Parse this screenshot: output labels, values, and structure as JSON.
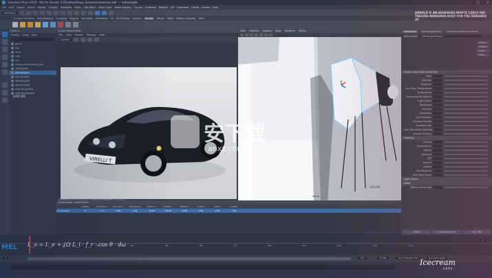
{
  "window": {
    "title": "Autodesk Maya 2018 - Not for Resale: E:\\Desktop\\Maya_Scenes\\scenes\\car.mb* --- aiAreaLight",
    "controls": [
      "–",
      "□",
      "×"
    ]
  },
  "menubar": {
    "items": [
      "File",
      "Edit",
      "Create",
      "Select",
      "Modify",
      "Display",
      "Windows",
      "Mesh",
      "Edit Mesh",
      "Mesh Tools",
      "Mesh Display",
      "Curves",
      "Surfaces",
      "Deform",
      "UV",
      "Generate",
      "Cache",
      "Arnold",
      "Help"
    ]
  },
  "statusline": {
    "mode": "Modeling",
    "workspace": "Workspace: Maya Classic"
  },
  "shelf": {
    "tabs": [
      "Curves / Surfaces",
      "Poly Modeling",
      "Sculpting",
      "Rigging",
      "Animation",
      "Rendering",
      "FX",
      "FX Caching",
      "Custom",
      "Arnold",
      "Bifrost",
      "MASH",
      "Motion Graphics",
      "XGen"
    ],
    "active_tab": "Arnold"
  },
  "outliner": {
    "title": "Outliner",
    "menus": [
      "Display",
      "Show",
      "Help"
    ],
    "items": [
      "persp",
      "top",
      "front",
      "side",
      "car",
      "studio_environment_grp",
      "aiSkyDome",
      "aiAreaLight1",
      "aiAreaLight2",
      "aiAreaLight3",
      "aiAreaLight4",
      "defaultLightSet",
      "defaultObjectSet"
    ],
    "selected_index": 7,
    "sticky_note": "$49.99"
  },
  "render_view": {
    "title": "Arnold RenderView",
    "menus": [
      "File",
      "View",
      "Render",
      "Window",
      "Help"
    ],
    "camera": "Camera",
    "plate": "VIRELLI T",
    "status": "Rendering 100%   [00:00:32]   1920x1080   Samples: 3/2/2/2/2/2"
  },
  "viewport": {
    "menus": [
      "View",
      "Shading",
      "Lighting",
      "Show",
      "Renderer",
      "Panels"
    ],
    "hud_price": "$12.99",
    "bottom_label": "persp",
    "callout": "$12.99"
  },
  "attribute_editor": {
    "tabs": [
      "aiAreaLight",
      "aiAreaLightShape1",
      "defaultArnoldRenderOptions"
    ],
    "buttons": [
      "Focus",
      "Presets",
      "Show",
      "Hide"
    ],
    "node_label": "aiAreaLight:",
    "node_value": "aiAreaLightShape1",
    "sections": [
      {
        "title": "Arnold Area Light Attributes",
        "rows": [
          "Color",
          "Intensity",
          "Exposure",
          "Use Color Temperature",
          "Temperature",
          "Illuminates By Default",
          "Light Shape",
          "Resolution",
          "Samples",
          "Normalize",
          "Cast Shadows",
          "Shadow Density",
          "Shadow Color",
          "Cast Volumetric Shadows",
          "Volume Samples"
        ]
      },
      {
        "title": "Visibility",
        "rows": [
          "Camera",
          "Transmission",
          "Diffuse",
          "Specular",
          "SSS",
          "Indirect",
          "Volume",
          "Max Bounces",
          "AOV Light Group"
        ]
      },
      {
        "title": "Light Filters",
        "rows": []
      },
      {
        "title": "Notes",
        "rows": [
          "Notes: aiAreaLight"
        ]
      }
    ],
    "footer_buttons": [
      "Select",
      "Load Attributes",
      "Copy Tab"
    ],
    "banner": "ARNOLD IS AN ADVANCED MONTE CARLO RAY TRACING RENDERER BUILT FOR THE DEMANDS OF"
  },
  "graph_editor": {
    "title": "Hypershade / Node Editor",
    "columns": [
      "Visibility",
      "Translate X",
      "Translate Y",
      "Translate Z",
      "Rotate X",
      "Rotate Y",
      "Rotate Z",
      "Scale X",
      "Scale Y",
      "Scale Z"
    ],
    "row": [
      "aiAreaLight1",
      "on",
      "-1.13",
      "0.69",
      "1.36",
      "-10.00",
      "-60.00",
      "-9.00",
      "1.00",
      "1.00",
      "1.00"
    ]
  },
  "timeline": {
    "ticks": [
      "10",
      "20",
      "30",
      "40",
      "50",
      "60",
      "70",
      "80",
      "90",
      "100",
      "110",
      "120"
    ],
    "current_frame": "1",
    "range_start": "1",
    "range_end": "120",
    "fps": "24 fps",
    "char_set": "No Character Set",
    "anim_layer": "No Anim Layer"
  },
  "command_line": {
    "lang": "MEL",
    "equation": "L_o = L_e + ∫Ω L_i · f_r · cos θ · dω"
  },
  "watermark": {
    "chars": "安下载",
    "sub": "anxz.com",
    "logo": "Icecream",
    "logo_sub": "APPS"
  },
  "colors": {
    "accent": "#2f7fd1",
    "selection": "#3e6da3",
    "panel": "#3a404c",
    "bg": "#2b3446",
    "softbox_edge": "#7fd8ff"
  }
}
